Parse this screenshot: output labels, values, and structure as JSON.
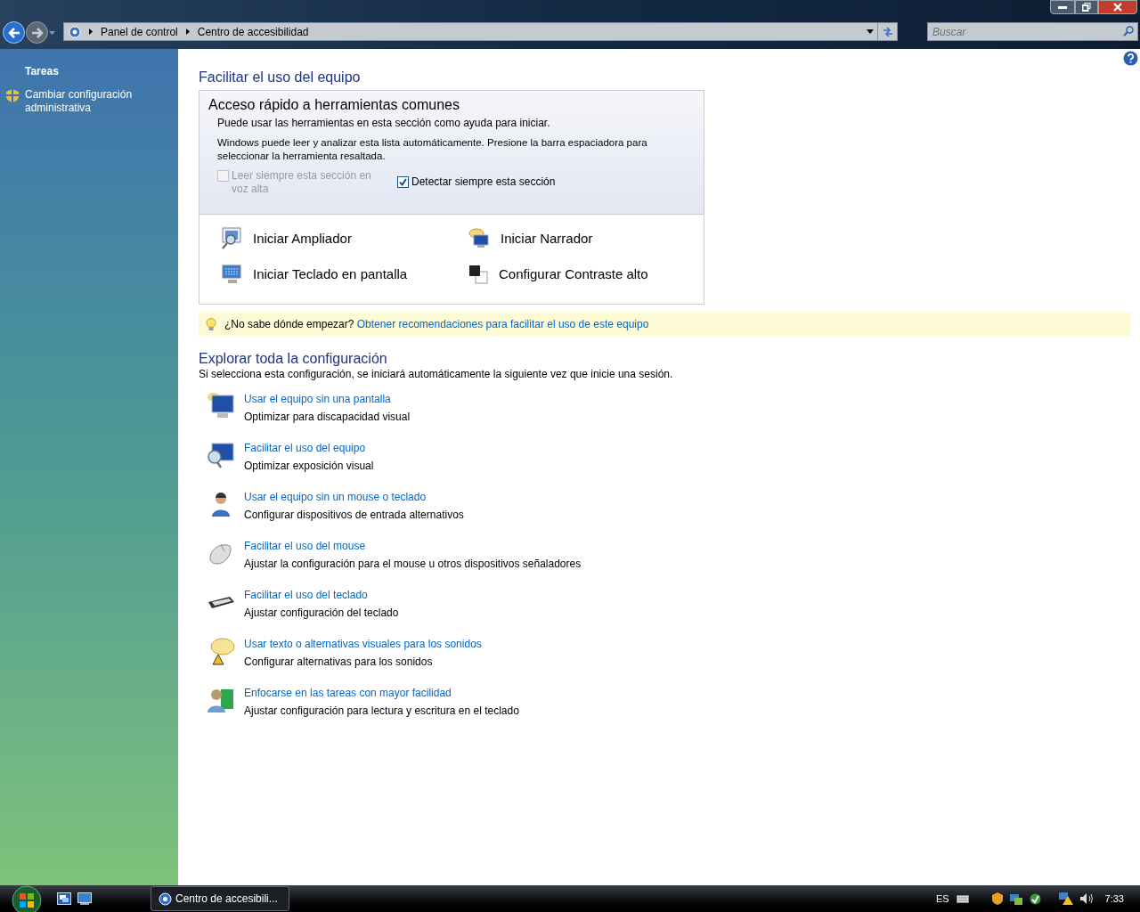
{
  "address_bar": {
    "breadcrumbs": [
      "Panel de control",
      "Centro de accesibilidad"
    ]
  },
  "search": {
    "placeholder": "Buscar"
  },
  "sidebar": {
    "title": "Tareas",
    "items": [
      {
        "label": "Cambiar configuración administrativa"
      }
    ]
  },
  "page_title": "Facilitar el uso del equipo",
  "quick_access": {
    "title": "Acceso rápido a herramientas comunes",
    "intro": "Puede usar las herramientas en esta sección como ayuda para iniciar.",
    "description": "Windows puede leer y analizar esta lista automáticamente. Presione la barra espaciadora para seleccionar la herramienta resaltada.",
    "options": [
      {
        "label": "Leer siempre esta sección en voz alta",
        "checked": false,
        "disabled": true
      },
      {
        "label": "Detectar siempre esta sección",
        "checked": true,
        "disabled": false
      }
    ],
    "tools": [
      {
        "label": "Iniciar Ampliador"
      },
      {
        "label": "Iniciar Narrador"
      },
      {
        "label": "Iniciar Teclado en pantalla"
      },
      {
        "label": "Configurar Contraste alto"
      }
    ]
  },
  "tip": {
    "question": "¿No sabe dónde empezar?",
    "link": "Obtener recomendaciones para facilitar el uso de este equipo"
  },
  "explore": {
    "title": "Explorar toda la configuración",
    "subtitle": "Si selecciona esta configuración, se iniciará automáticamente la siguiente vez que inicie una sesión.",
    "items": [
      {
        "link": "Usar el equipo sin una pantalla",
        "description": "Optimizar para discapacidad visual"
      },
      {
        "link": "Facilitar el uso del equipo",
        "description": "Optimizar exposición visual"
      },
      {
        "link": "Usar el equipo sin un mouse o teclado",
        "description": "Configurar dispositivos de entrada alternativos"
      },
      {
        "link": "Facilitar el uso del mouse",
        "description": "Ajustar la configuración para el mouse u otros dispositivos señaladores"
      },
      {
        "link": "Facilitar el uso del teclado",
        "description": "Ajustar configuración del teclado"
      },
      {
        "link": "Usar texto o alternativas visuales para los sonidos",
        "description": "Configurar alternativas para los sonidos"
      },
      {
        "link": "Enfocarse en las tareas con mayor facilidad",
        "description": "Ajustar configuración para lectura y escritura en el teclado"
      }
    ]
  },
  "taskbar": {
    "window_button": "Centro de accesibili...",
    "language": "ES",
    "clock": "7:33"
  }
}
